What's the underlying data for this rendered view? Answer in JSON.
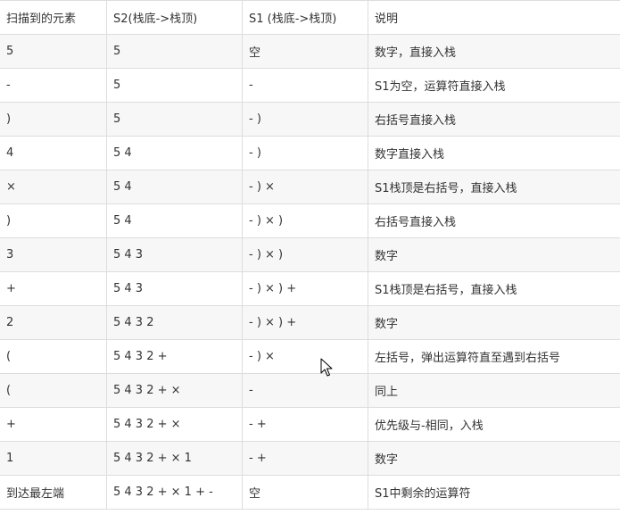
{
  "headers": [
    "扫描到的元素",
    "S2(栈底->栈顶)",
    "S1 (栈底->栈顶)",
    "说明"
  ],
  "rows": [
    [
      "5",
      "5",
      "空",
      "数字，直接入栈"
    ],
    [
      "-",
      "5",
      "-",
      "S1为空，运算符直接入栈"
    ],
    [
      ")",
      "5",
      "- )",
      "右括号直接入栈"
    ],
    [
      "4",
      "5 4",
      "- )",
      "数字直接入栈"
    ],
    [
      "×",
      "5 4",
      "- ) ×",
      "S1栈顶是右括号，直接入栈"
    ],
    [
      ")",
      "5 4",
      "- ) × )",
      "右括号直接入栈"
    ],
    [
      "3",
      "5 4 3",
      "- ) × )",
      "数字"
    ],
    [
      "+",
      "5 4 3",
      "- ) × ) +",
      "S1栈顶是右括号，直接入栈"
    ],
    [
      "2",
      "5 4 3 2",
      "- ) × ) +",
      "数字"
    ],
    [
      "(",
      "5 4 3 2 +",
      "- ) ×",
      "左括号，弹出运算符直至遇到右括号"
    ],
    [
      "(",
      "5 4 3 2 + ×",
      "-",
      "同上"
    ],
    [
      "+",
      "5 4 3 2 + ×",
      "- +",
      "优先级与-相同，入栈"
    ],
    [
      "1",
      "5 4 3 2 + × 1",
      "- +",
      "数字"
    ],
    [
      "到达最左端",
      "5 4 3 2 + × 1 + -",
      "空",
      "S1中剩余的运算符"
    ]
  ]
}
